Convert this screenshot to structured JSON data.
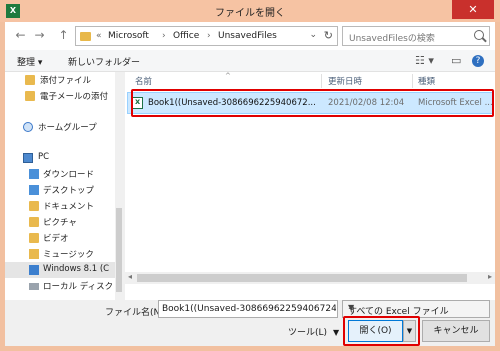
{
  "window": {
    "title": "ファイルを開く",
    "close_glyph": "✕",
    "app_icon_letter": "X"
  },
  "nav": {
    "back_glyph": "←",
    "forward_glyph": "→",
    "up_glyph": "↑",
    "breadcrumb_prefix": "«",
    "breadcrumbs": [
      "Microsoft",
      "Office",
      "UnsavedFiles"
    ],
    "separator": "›",
    "refresh_glyph": "↻",
    "dropdown_glyph": "⌄",
    "search_placeholder": "UnsavedFilesの検索"
  },
  "toolbar": {
    "organize_label": "整理 ▾",
    "new_folder_label": "新しいフォルダー",
    "view_glyph": "☷ ▾",
    "pane_glyph": "▭",
    "help_glyph": "?"
  },
  "sidebar": {
    "items": [
      {
        "label": "添付ファイル",
        "icon": "folder-icon"
      },
      {
        "label": "電子メールの添付",
        "icon": "folder-icon"
      },
      {
        "label": "ホームグループ",
        "icon": "homegroup-icon"
      },
      {
        "label": "PC",
        "icon": "pc-icon"
      },
      {
        "label": "ダウンロード",
        "icon": "download-icon"
      },
      {
        "label": "デスクトップ",
        "icon": "desktop-icon"
      },
      {
        "label": "ドキュメント",
        "icon": "documents-icon"
      },
      {
        "label": "ピクチャ",
        "icon": "pictures-icon"
      },
      {
        "label": "ビデオ",
        "icon": "videos-icon"
      },
      {
        "label": "ミュージック",
        "icon": "music-icon"
      },
      {
        "label": "Windows 8.1 (C",
        "icon": "windows-drive-icon"
      },
      {
        "label": "ローカル ディスク (E",
        "icon": "drive-icon"
      }
    ]
  },
  "file_list": {
    "columns": {
      "name": "名前",
      "modified": "更新日時",
      "type": "種類"
    },
    "sort_glyph": "^",
    "rows": [
      {
        "name": "Book1((Unsaved-3086696225940672...",
        "modified": "2021/02/08 12:04",
        "type": "Microsoft Excel ..."
      }
    ]
  },
  "bottom": {
    "filename_label": "ファイル名(N):",
    "filename_value": "Book1((Unsaved-308669622594067244",
    "filter_value": "すべての Excel ファイル",
    "tools_label": "ツール(L)",
    "open_label": "開く(O)",
    "cancel_label": "キャンセル"
  },
  "colors": {
    "titlebar": "#f6c3a3",
    "close": "#c9302c",
    "highlight": "#e00000",
    "selection": "#cce8ff"
  }
}
